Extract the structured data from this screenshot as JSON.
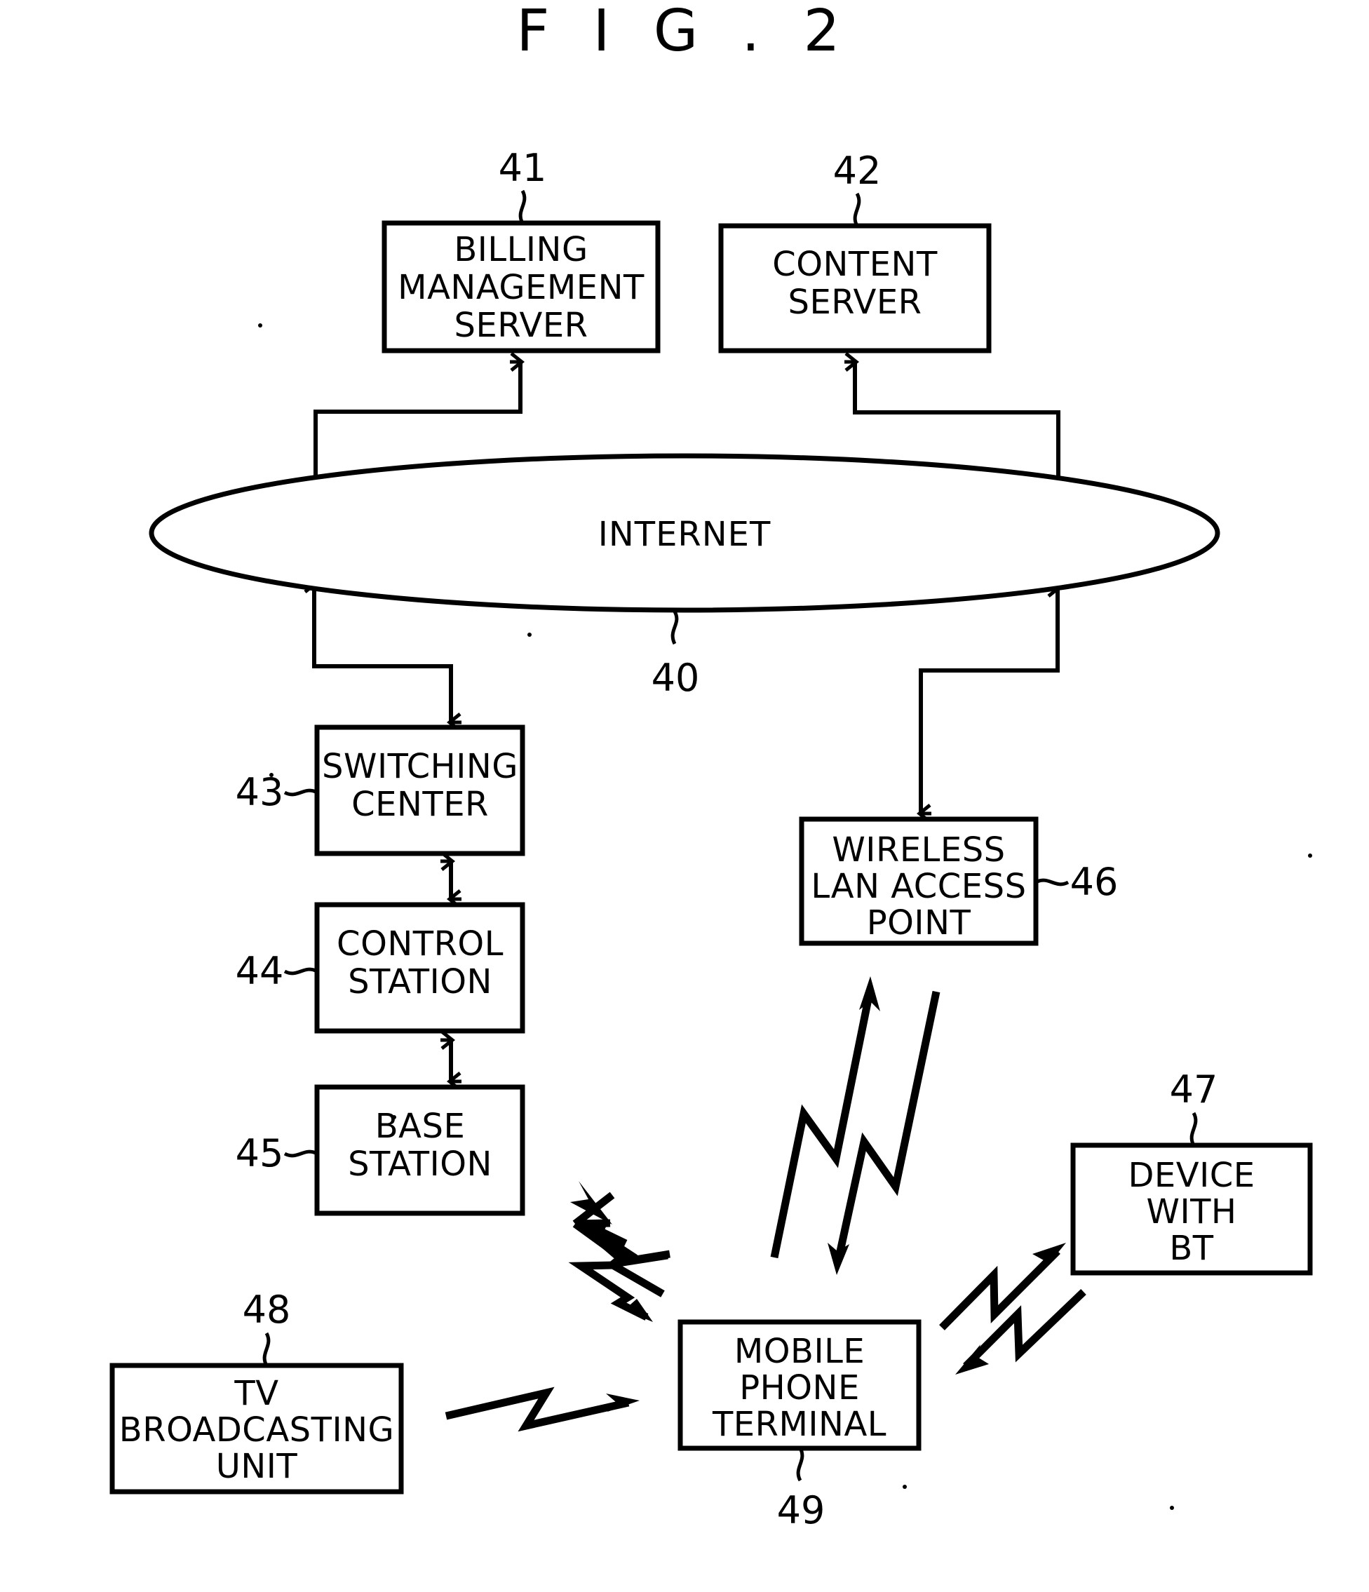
{
  "figure": {
    "title": "F I G . 2",
    "title_plain": "FIG.2"
  },
  "nodes": {
    "billing_management_server": {
      "ref": "41",
      "line1": "BILLING",
      "line2": "MANAGEMENT",
      "line3": "SERVER"
    },
    "content_server": {
      "ref": "42",
      "line1": "CONTENT",
      "line2": "SERVER"
    },
    "internet": {
      "ref": "40",
      "label": "INTERNET"
    },
    "switching_center": {
      "ref": "43",
      "line1": "SWITCHING",
      "line2": "CENTER"
    },
    "control_station": {
      "ref": "44",
      "line1": "CONTROL",
      "line2": "STATION"
    },
    "base_station": {
      "ref": "45",
      "line1": "BASE",
      "line2": "STATION"
    },
    "wireless_lan_access_point": {
      "ref": "46",
      "line1": "WIRELESS",
      "line2": "LAN ACCESS",
      "line3": "POINT"
    },
    "device_with_bt": {
      "ref": "47",
      "line1": "DEVICE",
      "line2": "WITH",
      "line3": "BT"
    },
    "tv_broadcasting_unit": {
      "ref": "48",
      "line1": "TV",
      "line2": "BROADCASTING",
      "line3": "UNIT"
    },
    "mobile_phone_terminal": {
      "ref": "49",
      "line1": "MOBILE",
      "line2": "PHONE",
      "line3": "TERMINAL"
    }
  },
  "colors": {
    "ink": "#000000",
    "paper": "#ffffff"
  }
}
